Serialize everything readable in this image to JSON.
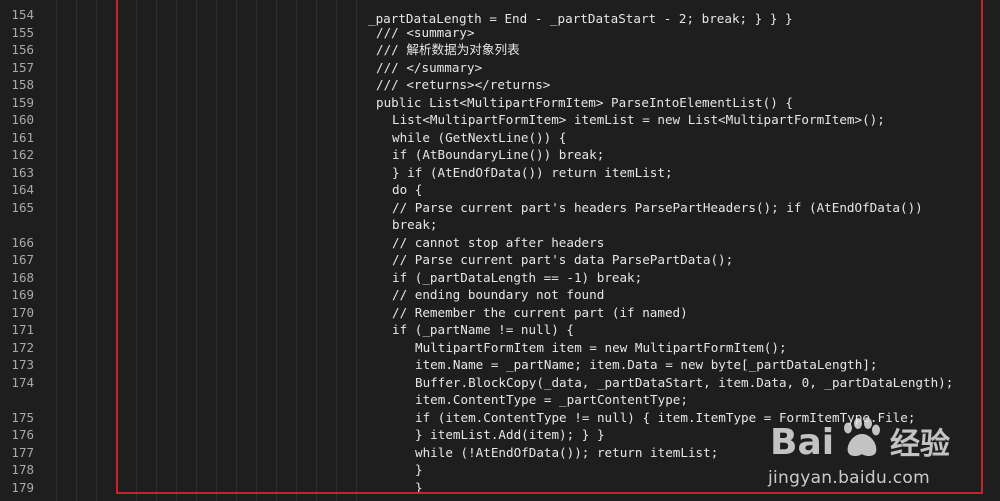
{
  "editor": {
    "top_partial_line": "_partDataLength = End - _partDataStart - 2; break; } } }",
    "lines": [
      {
        "num": "154",
        "indent": 0,
        "text": ""
      },
      {
        "num": "155",
        "indent": 0,
        "text": "/// <summary>"
      },
      {
        "num": "156",
        "indent": 0,
        "text": "/// 解析数据为对象列表"
      },
      {
        "num": "157",
        "indent": 0,
        "text": "/// </summary>"
      },
      {
        "num": "158",
        "indent": 0,
        "text": "/// <returns></returns>"
      },
      {
        "num": "159",
        "indent": 0,
        "text": "public List<MultipartFormItem> ParseIntoElementList() {"
      },
      {
        "num": "160",
        "indent": 1,
        "text": "List<MultipartFormItem> itemList = new List<MultipartFormItem>();"
      },
      {
        "num": "161",
        "indent": 1,
        "text": "while (GetNextLine()) {"
      },
      {
        "num": "162",
        "indent": 1,
        "text": "if (AtBoundaryLine()) break;"
      },
      {
        "num": "163",
        "indent": 1,
        "text": "} if (AtEndOfData()) return itemList;"
      },
      {
        "num": "164",
        "indent": 1,
        "text": "do {"
      },
      {
        "num": "165",
        "indent": 1,
        "text": "// Parse current part's headers ParsePartHeaders(); if (AtEndOfData())"
      },
      {
        "num": "",
        "indent": 1,
        "text": "break;"
      },
      {
        "num": "166",
        "indent": 1,
        "text": "// cannot stop after headers"
      },
      {
        "num": "167",
        "indent": 1,
        "text": "// Parse current part's data ParsePartData();"
      },
      {
        "num": "168",
        "indent": 1,
        "text": "if (_partDataLength == -1) break;"
      },
      {
        "num": "169",
        "indent": 1,
        "text": "// ending boundary not found"
      },
      {
        "num": "170",
        "indent": 1,
        "text": "// Remember the current part (if named)"
      },
      {
        "num": "171",
        "indent": 1,
        "text": "if (_partName != null) {"
      },
      {
        "num": "172",
        "indent": 2,
        "text": "MultipartFormItem item = new MultipartFormItem();"
      },
      {
        "num": "173",
        "indent": 2,
        "text": "item.Name = _partName; item.Data = new byte[_partDataLength];"
      },
      {
        "num": "174",
        "indent": 2,
        "text": "Buffer.BlockCopy(_data, _partDataStart, item.Data, 0, _partDataLength);"
      },
      {
        "num": "",
        "indent": 2,
        "text": "item.ContentType = _partContentType;"
      },
      {
        "num": "175",
        "indent": 2,
        "text": "if (item.ContentType != null) { item.ItemType = FormItemType.File;"
      },
      {
        "num": "176",
        "indent": 2,
        "text": "} itemList.Add(item); } }"
      },
      {
        "num": "177",
        "indent": 2,
        "text": "while (!AtEndOfData()); return itemList;"
      },
      {
        "num": "178",
        "indent": 2,
        "text": "}"
      },
      {
        "num": "179",
        "indent": 2,
        "text": "}"
      }
    ]
  },
  "watermark": {
    "logo_text": "Bai du 经验",
    "site_text": "jingyan.baidu.com"
  },
  "colors": {
    "background": "#1e1e1e",
    "line_number": "#a9a9a9",
    "code_text": "#e6e6e6",
    "highlight_border": "#c8232c"
  }
}
